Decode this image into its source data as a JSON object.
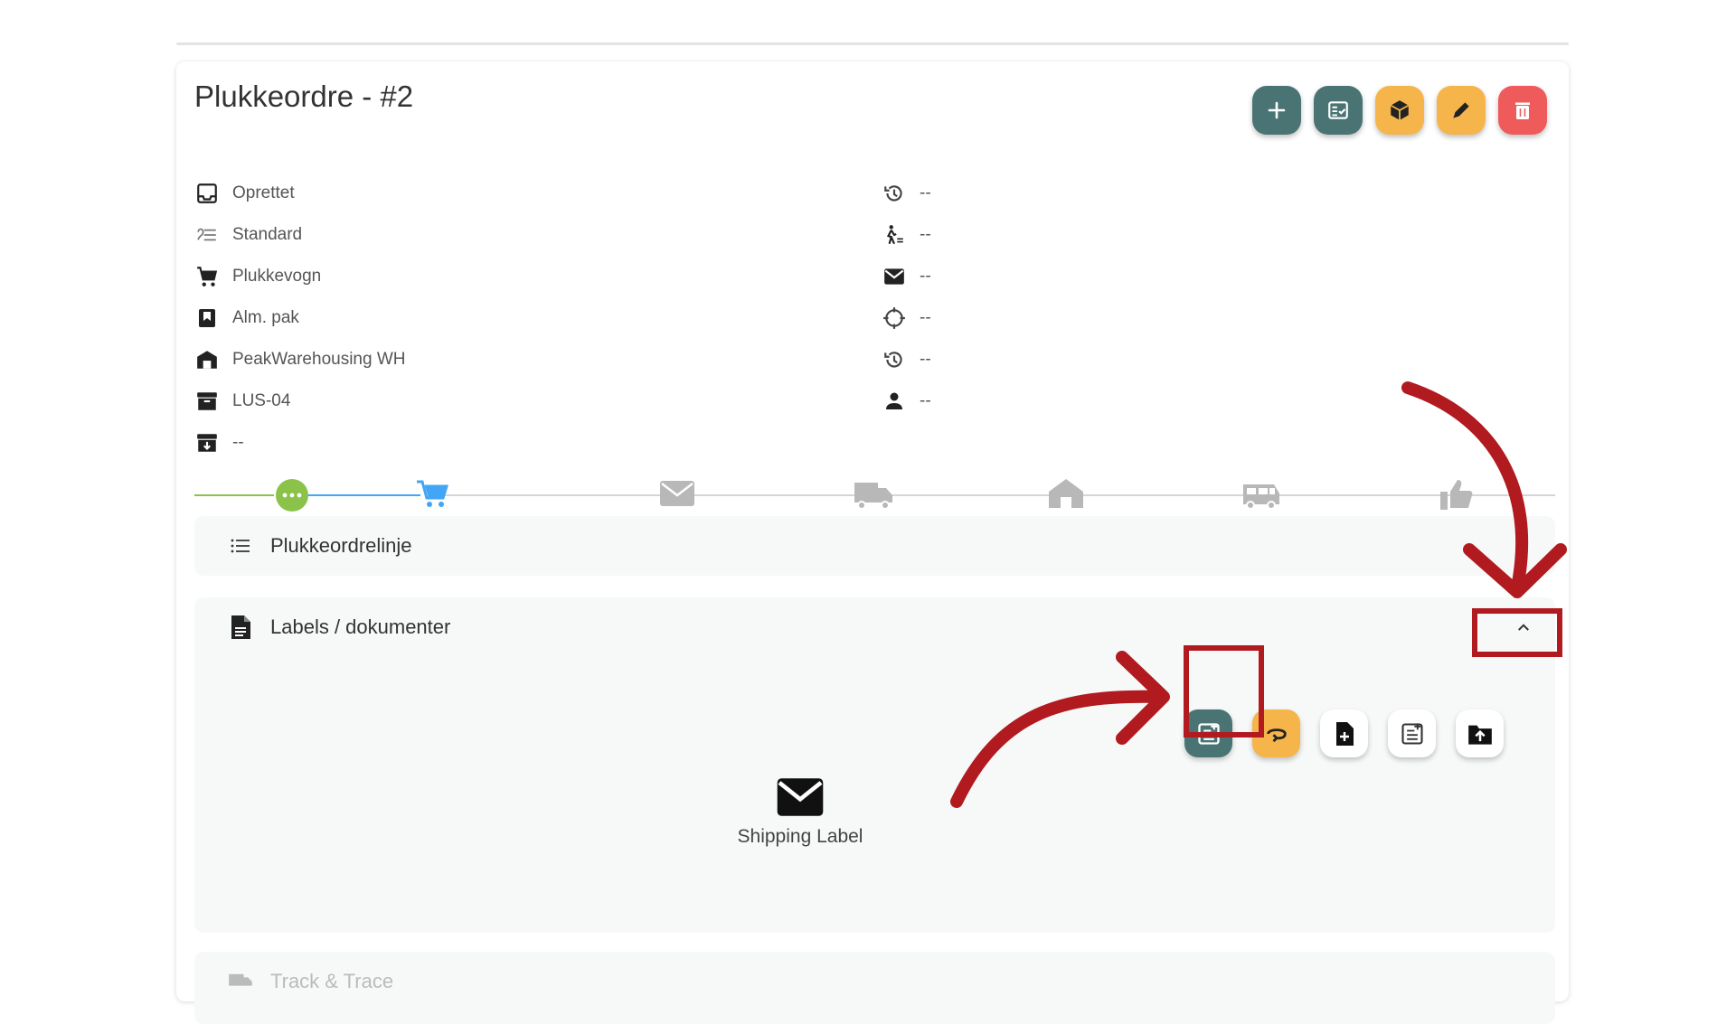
{
  "header": {
    "title": "Plukkeordre - #2"
  },
  "actions": [
    {
      "icon": "plus-icon",
      "color": "#4a7474"
    },
    {
      "icon": "checklist-icon",
      "color": "#4a7474"
    },
    {
      "icon": "package-icon",
      "color": "#f6b54a"
    },
    {
      "icon": "pencil-icon",
      "color": "#f6b54a"
    },
    {
      "icon": "trash-icon",
      "color": "#ef5a5a"
    }
  ],
  "details_left": [
    {
      "icon": "inbox-icon",
      "text": "Oprettet"
    },
    {
      "icon": "list-icon",
      "text": "Standard"
    },
    {
      "icon": "cart-icon",
      "text": "Plukkevogn"
    },
    {
      "icon": "bookmark-icon",
      "text": "Alm. pak"
    },
    {
      "icon": "warehouse-icon",
      "text": "PeakWarehousing WH"
    },
    {
      "icon": "archive-icon",
      "text": "LUS-04"
    },
    {
      "icon": "archive-down-icon",
      "text": "--"
    }
  ],
  "details_right": [
    {
      "icon": "history-icon",
      "text": "--"
    },
    {
      "icon": "walker-icon",
      "text": "--"
    },
    {
      "icon": "mail-icon",
      "text": "--"
    },
    {
      "icon": "crosshair-icon",
      "text": "--"
    },
    {
      "icon": "history-icon",
      "text": "--"
    },
    {
      "icon": "person-icon",
      "text": "--"
    }
  ],
  "stepper": {
    "steps": [
      "more-icon",
      "cart-icon",
      "mail-icon",
      "truck-icon",
      "home-icon",
      "van-icon",
      "thumbs-up-icon"
    ],
    "active_color": "#8bc34a",
    "current_color": "#42a5f5",
    "inactive_color": "#b8b8b8"
  },
  "sections": {
    "lines": {
      "label": "Plukkeordrelinje"
    },
    "labels": {
      "label": "Labels / dokumenter"
    },
    "track": {
      "label": "Track & Trace"
    }
  },
  "doc_buttons": [
    {
      "icon": "note-add-icon",
      "color": "#4a7474"
    },
    {
      "icon": "return-icon",
      "color": "#f6b54a"
    },
    {
      "icon": "file-plus-icon",
      "color": "#ffffff"
    },
    {
      "icon": "note-edit-icon",
      "color": "#ffffff"
    },
    {
      "icon": "folder-upload-icon",
      "color": "#ffffff"
    }
  ],
  "documents": [
    {
      "icon": "mail-icon",
      "label": "Shipping Label"
    }
  ],
  "annotation_color": "#b11a1f"
}
